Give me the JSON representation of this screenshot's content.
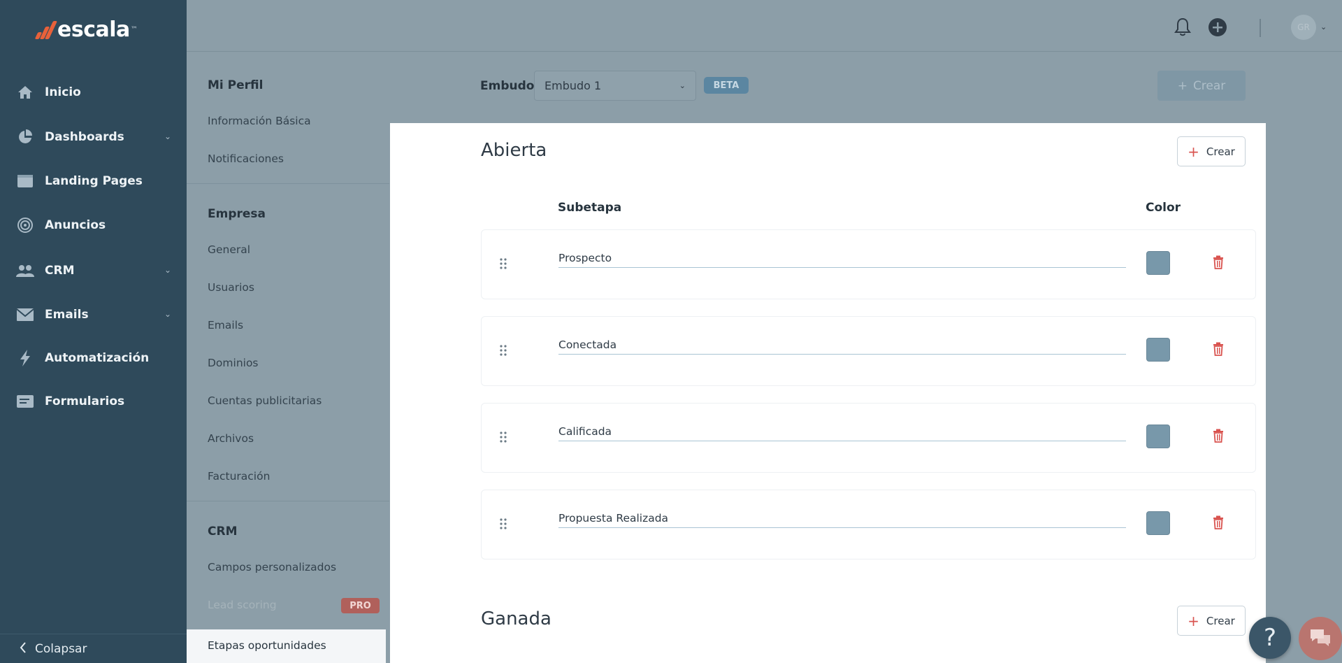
{
  "brand": {
    "name": "escala",
    "tm": "™"
  },
  "sidebar": {
    "items": [
      {
        "label": "Inicio",
        "icon": "home-icon",
        "has_chevron": false
      },
      {
        "label": "Dashboards",
        "icon": "pie-chart-icon",
        "has_chevron": true
      },
      {
        "label": "Landing Pages",
        "icon": "browser-window-icon",
        "has_chevron": false
      },
      {
        "label": "Anuncios",
        "icon": "target-icon",
        "has_chevron": false
      },
      {
        "label": "CRM",
        "icon": "users-icon",
        "has_chevron": true
      },
      {
        "label": "Emails",
        "icon": "envelope-icon",
        "has_chevron": true
      },
      {
        "label": "Automatización",
        "icon": "lightning-icon",
        "has_chevron": false
      },
      {
        "label": "Formularios",
        "icon": "form-icon",
        "has_chevron": false
      }
    ],
    "collapse_label": "Colapsar"
  },
  "topbar": {
    "avatar_initials": "GR",
    "icons": [
      "bell-icon",
      "plus-circle-icon",
      "chevron-down-icon"
    ]
  },
  "settings": {
    "sections": [
      {
        "title": "Mi Perfil",
        "items": [
          "Información Básica",
          "Notificaciones"
        ]
      },
      {
        "title": "Empresa",
        "items": [
          "General",
          "Usuarios",
          "Emails",
          "Dominios",
          "Cuentas publicitarias",
          "Archivos",
          "Facturación"
        ]
      },
      {
        "title": "CRM",
        "items": [
          "Campos personalizados",
          "Lead scoring",
          "Etapas oportunidades"
        ]
      }
    ],
    "pro_badge": "PRO",
    "active_item": "Etapas oportunidades"
  },
  "funnel": {
    "label": "Embudo",
    "selected": "Embudo 1",
    "beta_badge": "BETA",
    "create_label": "Crear"
  },
  "stages": [
    {
      "title": "Abierta",
      "create_label": "Crear",
      "columns": {
        "substage": "Subetapa",
        "color": "Color"
      },
      "substages": [
        {
          "name": "Prospecto",
          "color": "#7898aa"
        },
        {
          "name": "Conectada",
          "color": "#7898aa"
        },
        {
          "name": "Calificada",
          "color": "#7898aa"
        },
        {
          "name": "Propuesta Realizada",
          "color": "#7898aa"
        }
      ]
    },
    {
      "title": "Ganada",
      "create_label": "Crear"
    }
  ],
  "help": {
    "label": "?"
  },
  "colors": {
    "sidebar_bg": "#2f4a5b",
    "overlay": "#8c9ea8",
    "accent_red": "#d9534f",
    "brand_orange": "#e8613a",
    "swatch": "#7898aa"
  }
}
